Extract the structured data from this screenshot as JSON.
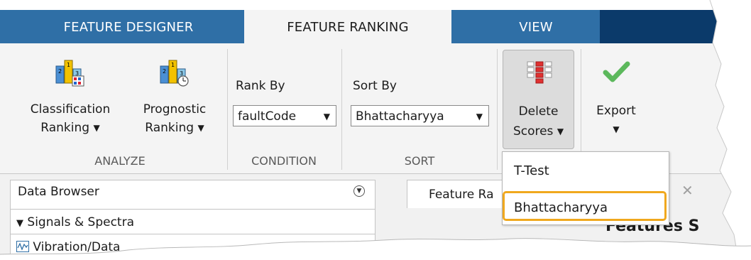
{
  "tabs": [
    "FEATURE DESIGNER",
    "FEATURE RANKING",
    "VIEW"
  ],
  "analyze": {
    "classification": {
      "line1": "Classification",
      "line2": "Ranking"
    },
    "prognostic": {
      "line1": "Prognostic",
      "line2": "Ranking"
    },
    "group_label": "ANALYZE"
  },
  "condition": {
    "label": "Rank By",
    "value": "faultCode",
    "group_label": "CONDITION"
  },
  "sort": {
    "label": "Sort By",
    "value": "Bhattacharyya",
    "group_label": "SORT"
  },
  "delete_scores": {
    "line1": "Delete",
    "line2": "Scores"
  },
  "export": {
    "label": "Export"
  },
  "menu": {
    "items": [
      "T-Test",
      "Bhattacharyya"
    ],
    "highlighted": "Bhattacharyya"
  },
  "data_browser": {
    "title": "Data Browser",
    "section": "Signals & Spectra",
    "item": "Vibration/Data"
  },
  "document_tab": {
    "label": "Feature Ra"
  },
  "content_title": "Features S",
  "colors": {
    "tab_bar": "#2f6fa6",
    "tab_dark": "#0b3a6a",
    "highlight": "#f0a81e",
    "check": "#5cb85c"
  },
  "icons": [
    "classification-ranking-icon",
    "prognostic-ranking-icon",
    "delete-scores-icon",
    "export-check-icon",
    "caret-down-icon",
    "collapse-icon",
    "close-icon",
    "signal-icon"
  ]
}
